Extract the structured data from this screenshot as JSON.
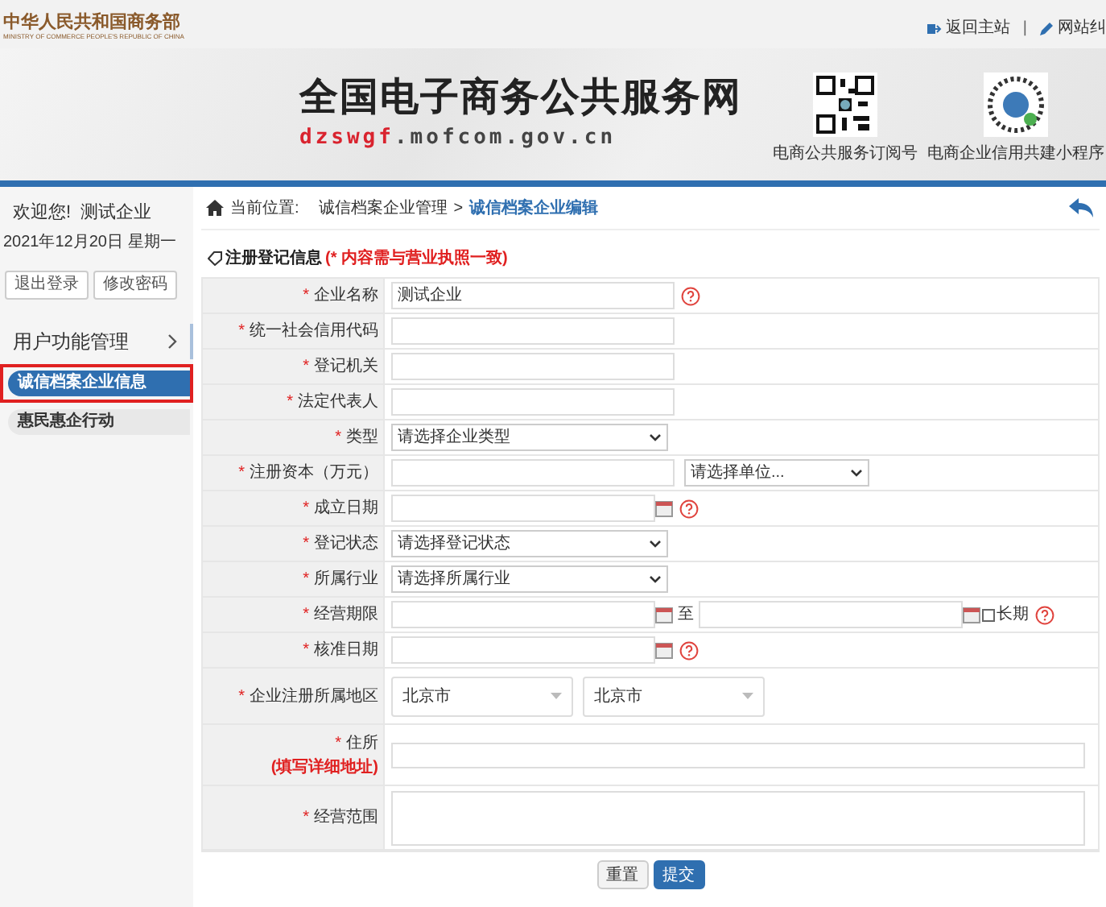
{
  "header": {
    "logo_title": "中华人民共和国商务部",
    "logo_subtitle": "MINISTRY OF COMMERCE PEOPLE'S REPUBLIC OF CHINA",
    "links": [
      {
        "label": "返回主站"
      },
      {
        "label": "网站纠"
      }
    ],
    "link_separator": "|"
  },
  "banner": {
    "title": "全国电子商务公共服务网",
    "url_highlight": "dzswgf",
    "url_rest": ".mofcom.gov.cn",
    "qr_codes": [
      {
        "caption": "电商公共服务订阅号",
        "kind": "square"
      },
      {
        "caption": "电商企业信用共建小程序",
        "kind": "round"
      }
    ]
  },
  "sidebar": {
    "welcome": "欢迎您!",
    "company": "测试企业",
    "date": "2021年12月20日 星期一",
    "buttons": [
      "退出登录",
      "修改密码"
    ],
    "menu_title": "用户功能管理",
    "items": [
      {
        "label": "诚信档案企业信息",
        "selected": true,
        "highlighted": true
      },
      {
        "label": "惠民惠企行动",
        "selected": false,
        "highlighted": false
      }
    ]
  },
  "breadcrumb": {
    "prefix": "当前位置:",
    "items": [
      {
        "label": "诚信档案企业管理",
        "current": false
      },
      {
        "label": "诚信档案企业编辑",
        "current": true
      }
    ],
    "separator": ">"
  },
  "form": {
    "title": "注册登记信息",
    "note": "(* 内容需与营业执照一致)",
    "fields": [
      {
        "star": "*",
        "label": "企业名称",
        "kind": "text",
        "value": "测试企业",
        "help": true
      },
      {
        "star": "*",
        "label": "统一社会信用代码",
        "kind": "text",
        "help": false
      },
      {
        "star": "*",
        "label": "登记机关",
        "kind": "text",
        "help": false
      },
      {
        "star": "*",
        "label": "法定代表人",
        "kind": "text",
        "help": false
      },
      {
        "star": "*",
        "label": "类型",
        "kind": "select",
        "value": "请选择企业类型",
        "help": false
      },
      {
        "star": "*",
        "label": "注册资本（万元）",
        "kind": "text_select",
        "select_value": "请选择单位...",
        "help": false
      },
      {
        "star": "*",
        "label": "成立日期",
        "kind": "date",
        "help": true
      },
      {
        "star": "*",
        "label": "登记状态",
        "kind": "select",
        "value": "请选择登记状态",
        "help": false
      },
      {
        "star": "*",
        "label": "所属行业",
        "kind": "select",
        "value": "请选择所属行业",
        "help": false
      },
      {
        "star": "*",
        "label": "经营期限",
        "kind": "date_range",
        "separator": "至",
        "checkbox_label": "长期",
        "checked": false,
        "help": true
      },
      {
        "star": "*",
        "label": "核准日期",
        "kind": "date",
        "help": true
      },
      {
        "star": "*",
        "label": "企业注册所属地区",
        "kind": "region",
        "selects": [
          "北京市",
          "北京市"
        ],
        "help": false
      },
      {
        "star": "*",
        "label": "住所",
        "kind": "address",
        "note": "(填写详细地址)",
        "help": false
      },
      {
        "star": "*",
        "label": "经营范围",
        "kind": "textarea",
        "help": false
      }
    ]
  },
  "buttons": [
    {
      "label": "重置",
      "primary": false
    },
    {
      "label": "提交",
      "primary": true
    }
  ]
}
